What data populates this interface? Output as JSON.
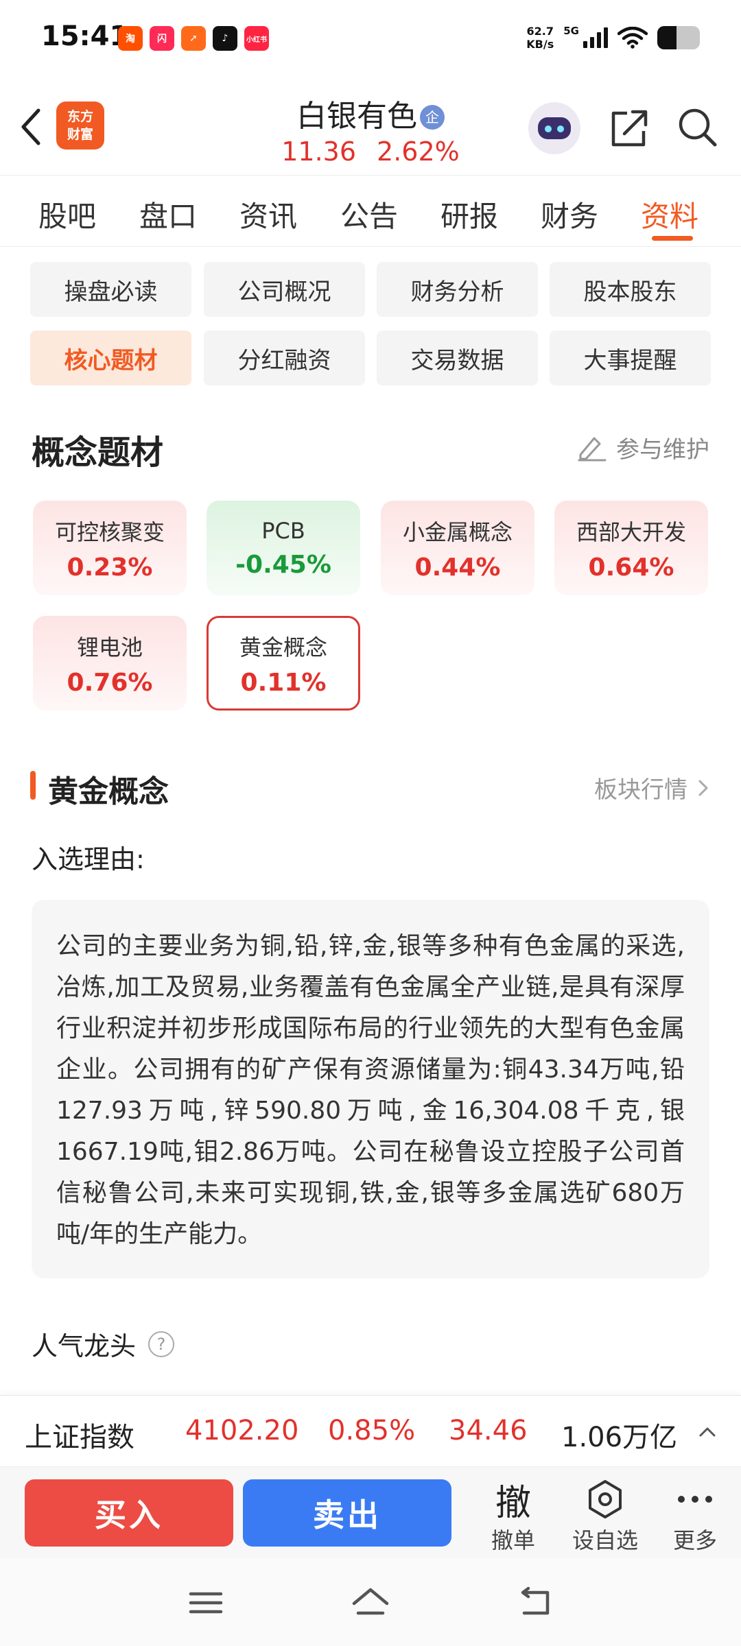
{
  "status_bar": {
    "time": "15:41",
    "apps": [
      {
        "icon": "taobao-icon",
        "glyph": "淘",
        "color": "#ff5000"
      },
      {
        "icon": "taobao-flash-icon",
        "glyph": "闪",
        "color": "#ff2a55"
      },
      {
        "icon": "paper-plane-app-icon",
        "glyph": "➚",
        "color": "#ff6a1a"
      },
      {
        "icon": "tiktok-icon",
        "glyph": "♪",
        "color": "#111111"
      },
      {
        "icon": "xiaohongshu-icon",
        "glyph": "小红书",
        "color": "#ff2442"
      }
    ],
    "speed_value": "62.7",
    "speed_unit": "KB/s",
    "network": "5G",
    "battery_level": 0.45
  },
  "header": {
    "brand_line1": "东方",
    "brand_line2": "财富",
    "stock_name": "白银有色",
    "badge": "企",
    "price": "11.36",
    "change_pct": "2.62%"
  },
  "tabs": [
    "股吧",
    "盘口",
    "资讯",
    "公告",
    "研报",
    "财务",
    "资料"
  ],
  "active_tab": "资料",
  "sub_tabs": [
    "操盘必读",
    "公司概况",
    "财务分析",
    "股本股东",
    "核心题材",
    "分红融资",
    "交易数据",
    "大事提醒"
  ],
  "active_sub_tab": "核心题材",
  "concepts": {
    "title": "概念题材",
    "maintain_label": "参与维护",
    "items": [
      {
        "name": "可控核聚变",
        "change": "0.23%",
        "trend": "up"
      },
      {
        "name": "PCB",
        "change": "-0.45%",
        "trend": "down"
      },
      {
        "name": "小金属概念",
        "change": "0.44%",
        "trend": "up"
      },
      {
        "name": "西部大开发",
        "change": "0.64%",
        "trend": "up"
      },
      {
        "name": "锂电池",
        "change": "0.76%",
        "trend": "up"
      },
      {
        "name": "黄金概念",
        "change": "0.11%",
        "trend": "selected"
      }
    ]
  },
  "detail": {
    "title": "黄金概念",
    "sector_link": "板块行情",
    "reason_label": "入选理由:",
    "reason_text": "公司的主要业务为铜,铅,锌,金,银等多种有色金属的采选,冶炼,加工及贸易,业务覆盖有色金属全产业链,是具有深厚行业积淀并初步形成国际布局的行业领先的大型有色金属企业。公司拥有的矿产保有资源储量为:铜43.34万吨,铅127.93万吨,锌590.80万吨,金16,304.08千克,银1667.19吨,钼2.86万吨。公司在秘鲁设立控股子公司首信秘鲁公司,未来可实现铜,铁,金,银等多金属选矿680万吨/年的生产能力。",
    "popular_label": "人气龙头",
    "help_glyph": "?"
  },
  "index_bar": {
    "name": "上证指数",
    "value": "4102.20",
    "change_pct": "0.85%",
    "change": "34.46",
    "amount": "1.06万亿"
  },
  "actions": {
    "buy": "买入",
    "sell": "卖出",
    "cancel_glyph": "撤",
    "cancel_label": "撤单",
    "watch_label": "设自选",
    "more_label": "更多"
  },
  "colors": {
    "accent": "#f15a22",
    "up": "#e2312b",
    "down": "#1a9a3a",
    "sell": "#3a7bf4"
  }
}
